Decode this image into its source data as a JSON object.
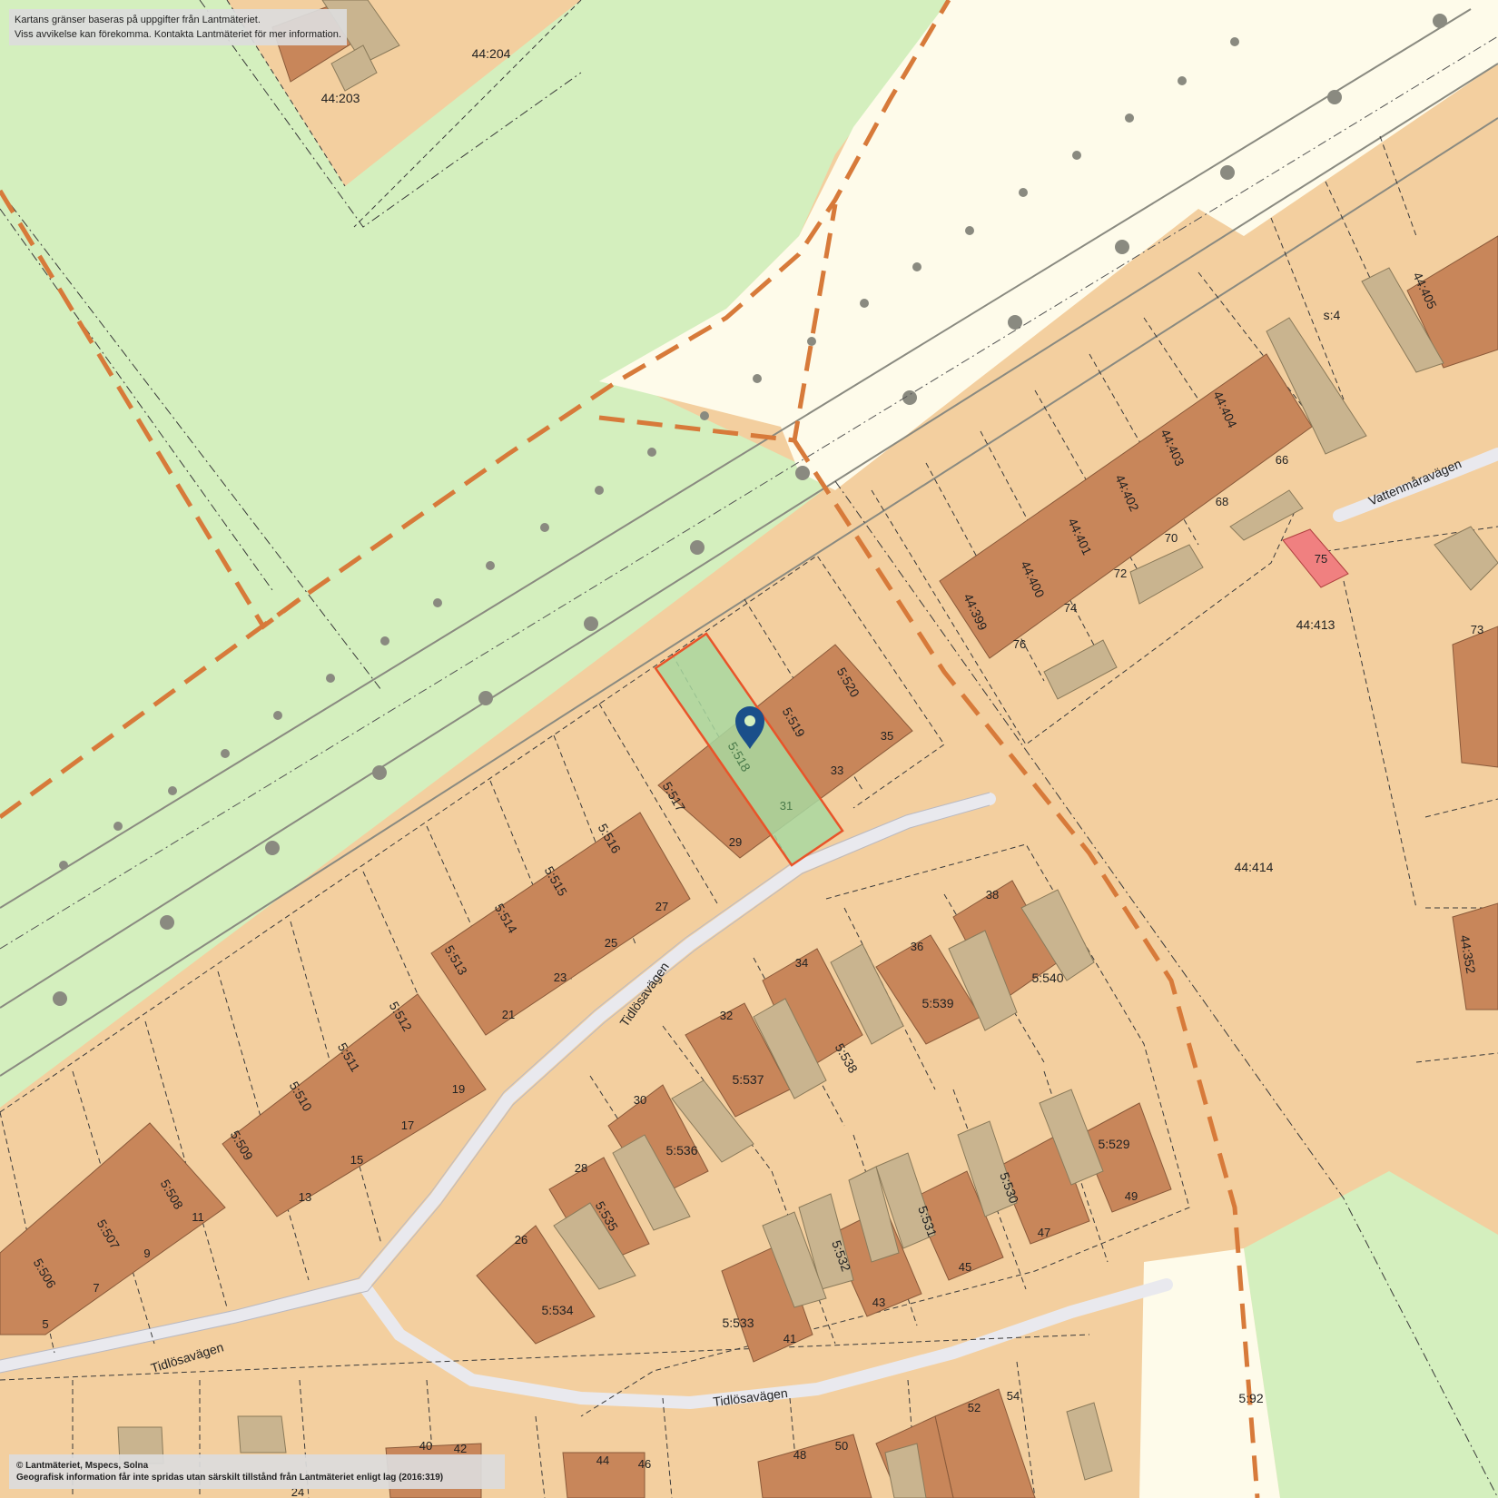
{
  "disclaimer": {
    "line1": "Kartans gränser baseras på uppgifter från Lantmäteriet.",
    "line2": "Viss avvikelse kan förekomma. Kontakta Lantmäteriet för mer information."
  },
  "copyright": {
    "line1": "© Lantmäteriet, Mspecs, Solna",
    "line2": "Geografisk information får inte spridas utan särskilt tillstånd från Lantmäteriet enligt lag (2016:319)"
  },
  "roads": {
    "road1": "Tidlösavägen",
    "road2": "Tidlösavägen",
    "road3": "Tidlösavägen",
    "road4": "Vattenmåravägen"
  },
  "parcels": {
    "p44_204": "44:204",
    "p44_203": "44:203",
    "s4": "s:4",
    "p44_405": "44:405",
    "p44_404": "44:404",
    "p44_403": "44:403",
    "p44_402": "44:402",
    "p44_401": "44:401",
    "p44_400": "44:400",
    "p44_399": "44:399",
    "p44_413": "44:413",
    "p44_414": "44:414",
    "p44_352": "44:352",
    "p5_520": "5:520",
    "p5_519": "5:519",
    "p5_518": "5:518",
    "p5_517": "5:517",
    "p5_516": "5:516",
    "p5_515": "5:515",
    "p5_514": "5:514",
    "p5_513": "5:513",
    "p5_512": "5:512",
    "p5_511": "5:511",
    "p5_510": "5:510",
    "p5_509": "5:509",
    "p5_508": "5:508",
    "p5_507": "5:507",
    "p5_506": "5:506",
    "p5_540": "5:540",
    "p5_539": "5:539",
    "p5_538": "5:538",
    "p5_537": "5:537",
    "p5_536": "5:536",
    "p5_535": "5:535",
    "p5_534": "5:534",
    "p5_533": "5:533",
    "p5_532": "5:532",
    "p5_531": "5:531",
    "p5_530": "5:530",
    "p5_529": "5:529",
    "p5_92": "5:92"
  },
  "addresses": {
    "a35": "35",
    "a33": "33",
    "a31": "31",
    "a29": "29",
    "a27": "27",
    "a25": "25",
    "a23": "23",
    "a21": "21",
    "a19": "19",
    "a17": "17",
    "a15": "15",
    "a13": "13",
    "a11": "11",
    "a9": "9",
    "a7": "7",
    "a5": "5",
    "a66": "66",
    "a68": "68",
    "a70": "70",
    "a72": "72",
    "a74": "74",
    "a76": "76",
    "a75": "75",
    "a73": "73",
    "a38": "38",
    "a36": "36",
    "a34": "34",
    "a32": "32",
    "a30": "30",
    "a28": "28",
    "a26": "26",
    "a49": "49",
    "a47": "47",
    "a45": "45",
    "a43": "43",
    "a41": "41",
    "a54": "54",
    "a52": "52",
    "a50": "50",
    "a48": "48",
    "a46": "46",
    "a44": "44",
    "a40": "40",
    "a42": "42",
    "a24": "24"
  },
  "colors": {
    "land": "#f3cf9f",
    "park": "#d4efbe",
    "rail_area": "#fefbea",
    "building": "#c8865a",
    "outbuilding": "#c9b48f",
    "selected_fill": "#a8d8a0",
    "selected_stroke": "#e8542a",
    "admin_boundary": "#d77a3a",
    "road": "#e9e9ee",
    "marker": "#1a4f8a",
    "highlight_building": "#f08080"
  }
}
